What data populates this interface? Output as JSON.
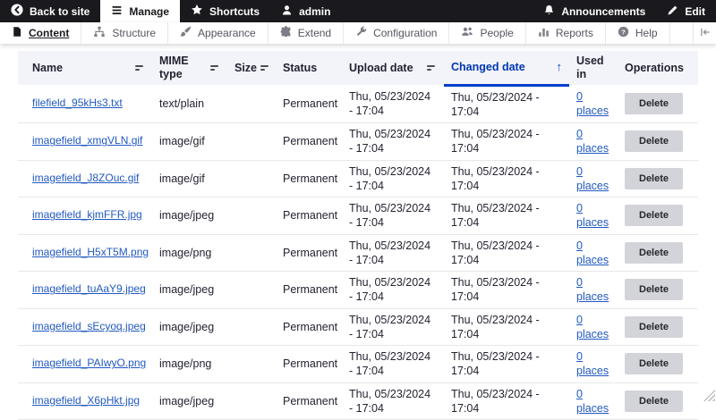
{
  "toolbar_top": {
    "items": [
      {
        "label": "Back to site",
        "icon": "back-arrow"
      },
      {
        "label": "Manage",
        "icon": "hamburger-menu",
        "active": true
      },
      {
        "label": "Shortcuts",
        "icon": "star"
      },
      {
        "label": "admin",
        "icon": "user"
      }
    ],
    "right_items": [
      {
        "label": "Announcements",
        "icon": "bell"
      },
      {
        "label": "Edit",
        "icon": "pencil"
      }
    ]
  },
  "admin_menu": {
    "tabs": [
      {
        "label": "Content",
        "icon": "document",
        "active": true
      },
      {
        "label": "Structure",
        "icon": "sitemap"
      },
      {
        "label": "Appearance",
        "icon": "paintbrush"
      },
      {
        "label": "Extend",
        "icon": "puzzle"
      },
      {
        "label": "Configuration",
        "icon": "wrench"
      },
      {
        "label": "People",
        "icon": "people"
      },
      {
        "label": "Reports",
        "icon": "bar-chart"
      },
      {
        "label": "Help",
        "icon": "help-circle"
      }
    ]
  },
  "files_table": {
    "headers": {
      "name": "Name",
      "mime": "MIME type",
      "size": "Size",
      "status": "Status",
      "uploaded": "Upload date",
      "changed": "Changed date",
      "used": "Used in",
      "ops": "Operations"
    },
    "sort": {
      "column": "Changed date",
      "direction": "ascending",
      "arrow": "↑"
    },
    "rows": [
      {
        "name": "filefield_95kHs3.txt",
        "mime": "text/plain",
        "size": "",
        "status": "Permanent",
        "uploaded": "Thu, 05/23/2024 - 17:04",
        "changed": "Thu, 05/23/2024 - 17:04",
        "used": "0 places",
        "op": "Delete"
      },
      {
        "name": "imagefield_xmgVLN.gif",
        "mime": "image/gif",
        "size": "",
        "status": "Permanent",
        "uploaded": "Thu, 05/23/2024 - 17:04",
        "changed": "Thu, 05/23/2024 - 17:04",
        "used": "0 places",
        "op": "Delete"
      },
      {
        "name": "imagefield_J8ZOuc.gif",
        "mime": "image/gif",
        "size": "",
        "status": "Permanent",
        "uploaded": "Thu, 05/23/2024 - 17:04",
        "changed": "Thu, 05/23/2024 - 17:04",
        "used": "0 places",
        "op": "Delete"
      },
      {
        "name": "imagefield_kjmFFR.jpg",
        "mime": "image/jpeg",
        "size": "",
        "status": "Permanent",
        "uploaded": "Thu, 05/23/2024 - 17:04",
        "changed": "Thu, 05/23/2024 - 17:04",
        "used": "0 places",
        "op": "Delete"
      },
      {
        "name": "imagefield_H5xT5M.png",
        "mime": "image/png",
        "size": "",
        "status": "Permanent",
        "uploaded": "Thu, 05/23/2024 - 17:04",
        "changed": "Thu, 05/23/2024 - 17:04",
        "used": "0 places",
        "op": "Delete"
      },
      {
        "name": "imagefield_tuAaY9.jpeg",
        "mime": "image/jpeg",
        "size": "",
        "status": "Permanent",
        "uploaded": "Thu, 05/23/2024 - 17:04",
        "changed": "Thu, 05/23/2024 - 17:04",
        "used": "0 places",
        "op": "Delete"
      },
      {
        "name": "imagefield_sEcyoq.jpeg",
        "mime": "image/jpeg",
        "size": "",
        "status": "Permanent",
        "uploaded": "Thu, 05/23/2024 - 17:04",
        "changed": "Thu, 05/23/2024 - 17:04",
        "used": "0 places",
        "op": "Delete"
      },
      {
        "name": "imagefield_PAIwyO.png",
        "mime": "image/png",
        "size": "",
        "status": "Permanent",
        "uploaded": "Thu, 05/23/2024 - 17:04",
        "changed": "Thu, 05/23/2024 - 17:04",
        "used": "0 places",
        "op": "Delete"
      },
      {
        "name": "imagefield_X6pHkt.jpg",
        "mime": "image/jpeg",
        "size": "",
        "status": "Permanent",
        "uploaded": "Thu, 05/23/2024 - 17:04",
        "changed": "Thu, 05/23/2024 - 17:04",
        "used": "0 places",
        "op": "Delete"
      }
    ]
  },
  "colors": {
    "accent": "#003ecc",
    "link": "#2159c2",
    "toolbar_bg": "#1a1a1e",
    "table_header_bg": "#f3f4f9",
    "button_bg": "#d3d4d9"
  }
}
